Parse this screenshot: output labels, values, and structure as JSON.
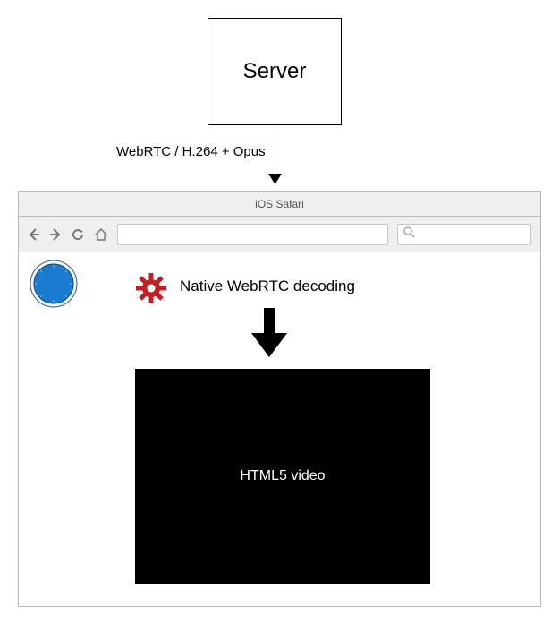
{
  "server": {
    "label": "Server"
  },
  "connection": {
    "label": "WebRTC / H.264 + Opus"
  },
  "browser": {
    "title": "iOS Safari",
    "url_value": "",
    "search_placeholder": ""
  },
  "content": {
    "decoding_label": "Native WebRTC decoding",
    "video_label": "HTML5 video"
  }
}
